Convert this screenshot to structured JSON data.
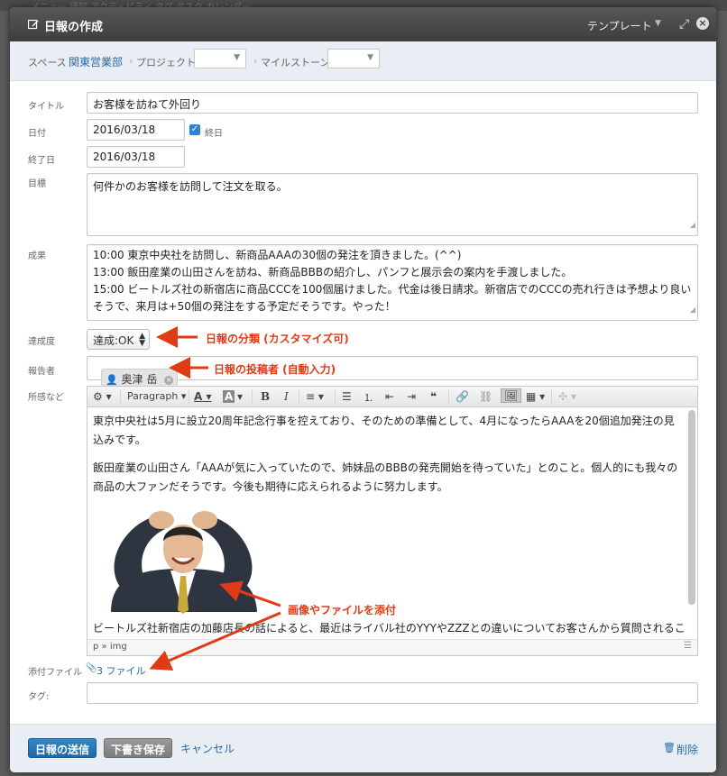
{
  "background": {
    "tabs": "メニュー  通知  アクティビティ  タグ  タスク  カレンダー"
  },
  "modal": {
    "title": "日報の作成",
    "template_label": "テンプレート",
    "expand_icon": "expand-icon",
    "close_icon": "close-icon"
  },
  "breadcrumb": {
    "space_label": "スペース",
    "space_value": "関東営業部",
    "project_label": "プロジェクト",
    "milestone_label": "マイルストーン",
    "sep": "›"
  },
  "form": {
    "title_label": "タイトル",
    "title_value": "お客様を訪ねて外回り",
    "date_label": "日付",
    "date_value": "2016/03/18",
    "allday_label": "終日",
    "enddate_label": "終了日",
    "enddate_value": "2016/03/18",
    "goal_label": "目標",
    "goal_value": "何件かのお客様を訪問して注文を取る。",
    "result_label": "成果",
    "result_value": "10:00 東京中央社を訪問し、新商品AAAの30個の発注を頂きました。(^^)\n13:00 飯田産業の山田さんを訪ね、新商品BBBの紹介し、パンフと展示会の案内を手渡しました。\n15:00 ビートルズ社の新宿店に商品CCCを100個届けました。代金は後日請求。新宿店でのCCCの売れ行きは予想より良い\nそうで、来月は+50個の発注をする予定だそうです。やった！",
    "achievement_label": "達成度",
    "achievement_value": "達成:OK",
    "reporter_label": "報告者",
    "reporter_value": "奥津 岳",
    "notes_label": "所感など",
    "attach_label": "添付ファイル",
    "attach_link": "3 ファイル",
    "tag_label": "タグ:"
  },
  "editor": {
    "paragraph_label": "Paragraph",
    "p1": "東京中央社は5月に設立20周年記念行事を控えており、そのための準備として、4月になったらAAAを20個追加発注の見込みです。",
    "p2": "飯田産業の山田さん「AAAが気に入っていたので、姉妹品のBBBの発売開始を待っていた」とのこと。個人的にも我々の商品の大ファンだそうです。今後も期待に応えられるように努力します。",
    "p3": "ビートルズ社新宿店の加藤店長の話によると、最近はライバル社のYYYやZZZとの違いについてお客さんから質問されるこ",
    "path": "p » img"
  },
  "annotations": {
    "a1": "日報の分類 (カスタマイズ可)",
    "a2": "日報の投稿者 (自動入力)",
    "a3": "画像やファイルを添付"
  },
  "footer": {
    "send": "日報の送信",
    "draft": "下書き保存",
    "cancel": "キャンセル",
    "delete": "削除"
  },
  "colors": {
    "accent": "#2a6aa8",
    "annotation": "#e03a16",
    "primary_button": "#1f69a8"
  }
}
